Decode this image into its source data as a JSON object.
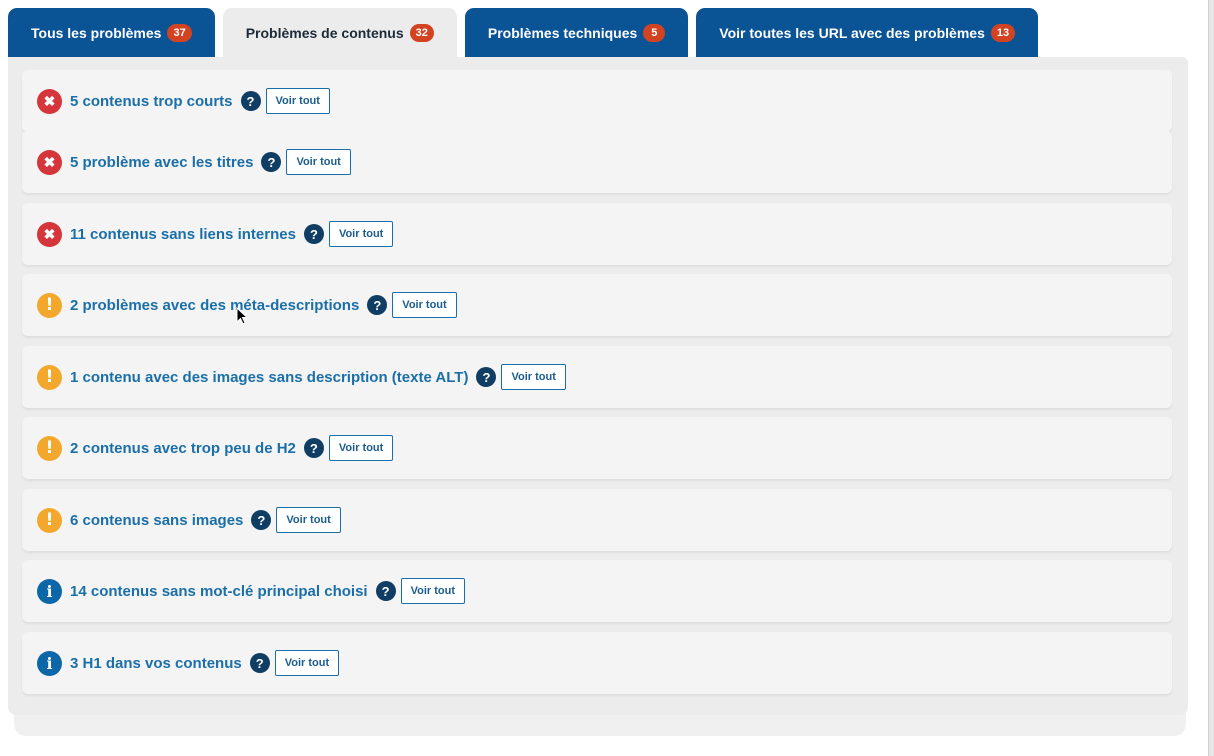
{
  "tabs": [
    {
      "label": "Tous les problèmes",
      "count": "37"
    },
    {
      "label": "Problèmes de contenus",
      "count": "32"
    },
    {
      "label": "Problèmes techniques",
      "count": "5"
    },
    {
      "label": "Voir toutes les URL avec des problèmes",
      "count": "13"
    }
  ],
  "active_tab": "Problèmes de contenus",
  "status_icons": {
    "error": "✖",
    "warning": "!",
    "info": "i",
    "help": "?"
  },
  "issues": [
    {
      "severity": "error",
      "icon": "error-icon",
      "label": "5 contenus trop courts",
      "button": "Voir tout"
    },
    {
      "severity": "error",
      "icon": "error-icon",
      "label": "5 problème avec les titres",
      "button": "Voir tout"
    },
    {
      "severity": "error",
      "icon": "error-icon",
      "label": "11 contenus sans liens internes",
      "button": "Voir tout"
    },
    {
      "severity": "warning",
      "icon": "warning-icon",
      "label": "2 problèmes avec des méta-descriptions",
      "button": "Voir tout"
    },
    {
      "severity": "warning",
      "icon": "warning-icon",
      "label": "1 contenu avec des images sans description (texte ALT)",
      "button": "Voir tout"
    },
    {
      "severity": "warning",
      "icon": "warning-icon",
      "label": "2 contenus avec trop peu de H2",
      "button": "Voir tout"
    },
    {
      "severity": "warning",
      "icon": "warning-icon",
      "label": "6 contenus sans images",
      "button": "Voir tout"
    },
    {
      "severity": "info",
      "icon": "info-icon",
      "label": "14 contenus sans mot-clé principal choisi",
      "button": "Voir tout"
    },
    {
      "severity": "info",
      "icon": "info-icon",
      "label": "3 H1 dans vos contenus",
      "button": "Voir tout"
    }
  ],
  "colors": {
    "tab_bg": "#0a5395",
    "tab_active_bg": "#ececec",
    "badge": "#d24322",
    "error": "#d4363b",
    "warning": "#f4a72d",
    "info": "#0c67a8",
    "link": "#1b6fa8",
    "help": "#0f3d64"
  }
}
